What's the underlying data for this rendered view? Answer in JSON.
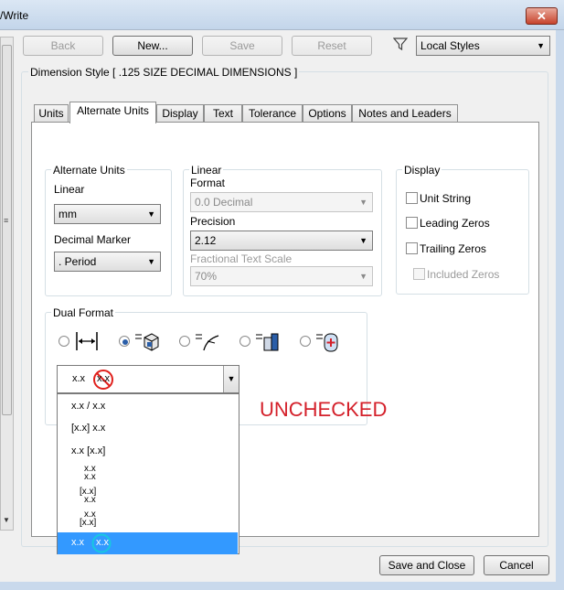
{
  "window": {
    "title": "/Write",
    "close_glyph": "✕"
  },
  "toolbar": {
    "back": "Back",
    "new": "New...",
    "save": "Save",
    "reset": "Reset",
    "filter_icon": "filter-icon",
    "styles_select": "Local Styles"
  },
  "dimension_style": "Dimension Style [ .125 SIZE DECIMAL DIMENSIONS ]",
  "tabs": [
    "Units",
    "Alternate Units",
    "Display",
    "Text",
    "Tolerance",
    "Options",
    "Notes and Leaders"
  ],
  "active_tab": "Alternate Units",
  "alternate_units": {
    "group_label": "Alternate Units",
    "linear_label": "Linear",
    "linear_value": "mm",
    "decimal_marker_label": "Decimal Marker",
    "decimal_marker_value": ". Period"
  },
  "linear_format": {
    "group_label": "Linear",
    "format_label": "Format",
    "format_value": "0.0 Decimal",
    "precision_label": "Precision",
    "precision_value": "2.12",
    "fractional_label": "Fractional Text Scale",
    "fractional_value": "70%"
  },
  "display": {
    "group_label": "Display",
    "unit_string": "Unit String",
    "leading_zeros": "Leading Zeros",
    "trailing_zeros": "Trailing Zeros",
    "included_zeros": "Included Zeros"
  },
  "dual_format": {
    "group_label": "Dual Format",
    "selected_index": 1,
    "combo_value": "x.x",
    "combo_value_2": "x.x",
    "options": [
      {
        "line1": "x.x / x.x"
      },
      {
        "line1": "[x.x] x.x"
      },
      {
        "line1": "x.x [x.x]"
      },
      {
        "line1": "x.x",
        "line2": "x.x"
      },
      {
        "line1": "[x.x]",
        "line2": "x.x"
      },
      {
        "line1": "x.x",
        "line2": "[x.x]"
      },
      {
        "line1": "x.x",
        "line2": "x.x"
      }
    ],
    "highlighted_option": 6
  },
  "annotation": {
    "text": "UNCHECKED",
    "color": "#d4202a"
  },
  "icon_colors": {
    "no_symbol": "#e0201c",
    "circle_highlight": "#18c8e0",
    "selection": "#3399ff"
  },
  "footer": {
    "save_close": "Save and Close",
    "cancel": "Cancel"
  }
}
